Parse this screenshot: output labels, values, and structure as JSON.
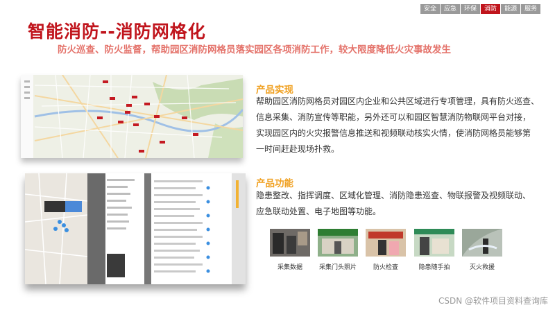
{
  "nav": {
    "tabs": [
      "安全",
      "应急",
      "环保",
      "消防",
      "能源",
      "服务"
    ],
    "active_index": 3
  },
  "header": {
    "title": "智能消防--消防网格化",
    "subtitle": "防火巡查、防火监督，帮助园区消防网格员落实园区各项消防工作，较大限度降低火灾事故发生"
  },
  "impl": {
    "heading": "产品实现",
    "lines": [
      "帮助园区消防网格员对园区内企业和公共区域进行专项管理，具有防火巡查、",
      "信息采集、消防宣传等职能，另外还可以和园区智慧消防物联网平台对接，",
      "实现园区内的火灾报警信息推送和视频联动核实火情，使消防网格员能够第",
      "一时间赶赴现场扑救。"
    ]
  },
  "func": {
    "heading": "产品功能",
    "lines": [
      "隐患整改、指挥调度、区域化管理、消防隐患巡查、物联报警及视频联动、",
      "应急联动处置、电子地图等功能。"
    ]
  },
  "photos": [
    {
      "caption": "采集数据",
      "icon": "data-collection-photo"
    },
    {
      "caption": "采集门头照片",
      "icon": "storefront-photo"
    },
    {
      "caption": "防火检查",
      "icon": "fire-inspection-photo"
    },
    {
      "caption": "隐患随手拍",
      "icon": "hazard-snapshot-photo"
    },
    {
      "caption": "灭火救援",
      "icon": "fire-rescue-photo"
    }
  ],
  "watermark": "CSDN @软件项目资料查询库",
  "colors": {
    "brand_red": "#c0141c",
    "accent_orange": "#f0a020",
    "subtitle_pink": "#e4726a"
  }
}
